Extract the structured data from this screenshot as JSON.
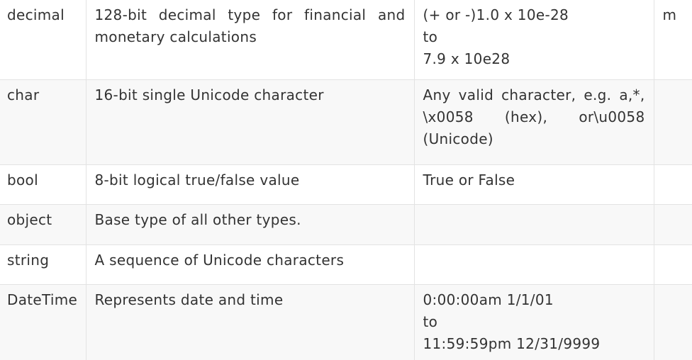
{
  "rows": [
    {
      "type": "decimal",
      "description": "128-bit decimal type for financial and monetary calculations",
      "range_lines": [
        "(+ or -)1.0 x 10e-28",
        "to",
        "7.9 x 10e28"
      ],
      "suffix": "m"
    },
    {
      "type": "char",
      "description": "16-bit single Unicode character",
      "range_lines": [
        "Any valid character, e.g. a,*, \\x0058 (hex), or\\u0058 (Unicode)"
      ],
      "suffix": ""
    },
    {
      "type": "bool",
      "description": "8-bit logical true/false value",
      "range_lines": [
        "True or False"
      ],
      "suffix": ""
    },
    {
      "type": "object",
      "description": "Base type of all other types.",
      "range_lines": [],
      "suffix": ""
    },
    {
      "type": "string",
      "description": "A sequence of Unicode characters",
      "range_lines": [],
      "suffix": ""
    },
    {
      "type": "DateTime",
      "description": "Represents date and time",
      "range_lines": [
        "0:00:00am 1/1/01",
        "to",
        "11:59:59pm 12/31/9999"
      ],
      "suffix": ""
    }
  ]
}
